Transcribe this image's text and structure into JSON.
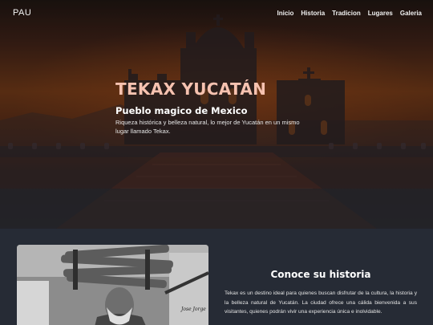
{
  "nav": {
    "brand": "PAU",
    "links": [
      "Inicio",
      "Historia",
      "Tradicion",
      "Lugares",
      "Galeria"
    ]
  },
  "hero": {
    "title": "TEKAX YUCATÁN",
    "subtitle": "Pueblo magico de Mexico",
    "description": "Riqueza histórica y belleza natural, lo mejor de Yucatán en un mismo lugar llamado Tekax."
  },
  "history": {
    "title": "Conoce su historia",
    "body": "Tekax es un destino ideal para quienes buscan disfrutar de la cultura, la historia y la belleza natural de Yucatán. La ciudad ofrece una cálida bienvenida a sus visitantes, quienes podrán vivir una experiencia única e inolvidable."
  },
  "photo": {
    "signature": "Jose Jorge"
  },
  "colors": {
    "page_background": "#262b35",
    "hero_title": "#f6c2b0",
    "sky_orange": "#6a3617"
  }
}
